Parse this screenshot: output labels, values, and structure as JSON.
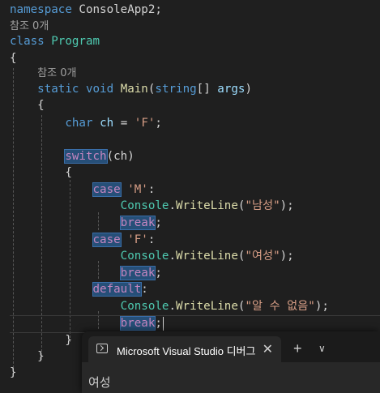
{
  "editor": {
    "tokens": {
      "namespace_kw": "namespace",
      "namespace_name": "ConsoleApp2;",
      "ref_count": "참조 0개",
      "class_kw": "class",
      "class_name": "Program",
      "brace_open": "{",
      "brace_close": "}",
      "static_kw": "static",
      "void_kw": "void",
      "main_fn": "Main",
      "paren_open": "(",
      "string_kw": "string",
      "array_brackets": "[]",
      "args_param": "args",
      "paren_close": ")",
      "char_kw": "char",
      "ch_var": "ch",
      "assign": "=",
      "char_F": "'F'",
      "semicolon": ";",
      "switch_kw": "switch",
      "switch_arg": "(ch)",
      "case_kw": "case",
      "char_M": "'M'",
      "colon": ":",
      "console_type": "Console",
      "dot": ".",
      "writeline_fn": "WriteLine",
      "str_male": "\"남성\"",
      "str_female": "\"여성\"",
      "str_unknown": "\"알 수 없음\"",
      "close_stmt": ");",
      "break_kw": "break",
      "default_kw": "default"
    }
  },
  "terminal": {
    "tab_title": "Microsoft Visual Studio 디버그",
    "close_glyph": "✕",
    "new_tab_glyph": "+",
    "dropdown_glyph": "∨",
    "output": "여성"
  }
}
